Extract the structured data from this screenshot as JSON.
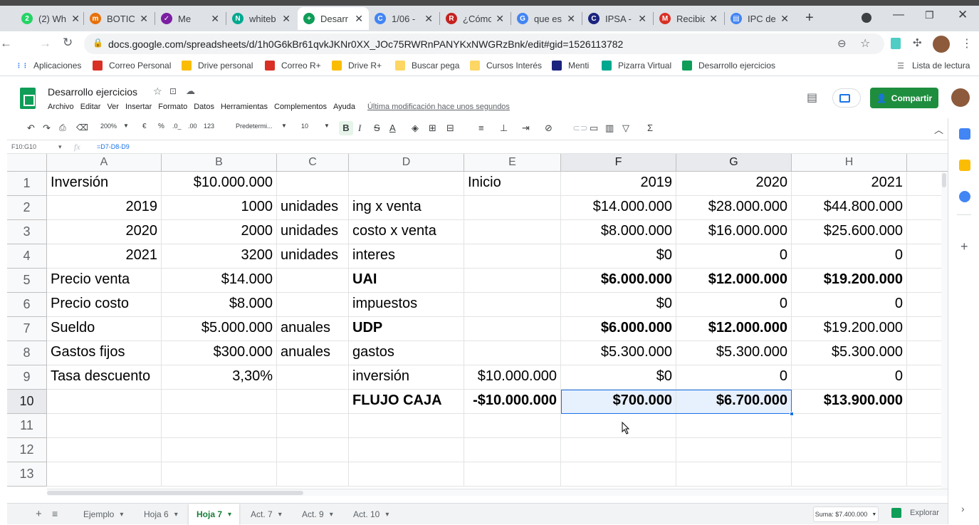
{
  "browser": {
    "tabs": [
      {
        "title": "(2) Wh",
        "icon_color": "#25d366",
        "icon_text": "2"
      },
      {
        "title": "BOTIC",
        "icon_color": "#e8710a",
        "icon_text": "m"
      },
      {
        "title": "Me",
        "icon_color": "#7b1fa2",
        "icon_text": "✓"
      },
      {
        "title": "whiteb",
        "icon_color": "#00a88f",
        "icon_text": "N"
      },
      {
        "title": "Desarr",
        "icon_color": "#0f9d58",
        "icon_text": "+"
      },
      {
        "title": "1/06 -",
        "icon_color": "#4285f4",
        "icon_text": "C"
      },
      {
        "title": "¿Cómo",
        "icon_color": "#c5221f",
        "icon_text": "R"
      },
      {
        "title": "que es",
        "icon_color": "#4285f4",
        "icon_text": "G"
      },
      {
        "title": "IPSA -",
        "icon_color": "#1a237e",
        "icon_text": "C"
      },
      {
        "title": "Recibid",
        "icon_color": "#d93025",
        "icon_text": "M"
      },
      {
        "title": "IPC de",
        "icon_color": "#4285f4",
        "icon_text": "▤"
      }
    ],
    "new_tab_symbol": "+",
    "url": "docs.google.com/spreadsheets/d/1h0G6kBr61qvkJKNr0XX_JOc75RWRnPANYKxNWGRzBnk/edit#gid=1526113782",
    "bookmarks": [
      {
        "label": "Aplicaciones",
        "icon": "apps-icon",
        "color": "#4285f4"
      },
      {
        "label": "Correo Personal",
        "icon": "gmail-icon",
        "color": "#d93025"
      },
      {
        "label": "Drive personal",
        "icon": "drive-icon",
        "color": "#fbbc04"
      },
      {
        "label": "Correo R+",
        "icon": "gmail-icon",
        "color": "#d93025"
      },
      {
        "label": "Drive R+",
        "icon": "drive-icon",
        "color": "#fbbc04"
      },
      {
        "label": "Buscar pega",
        "icon": "folder-icon",
        "color": "#fdd663"
      },
      {
        "label": "Cursos Interés",
        "icon": "folder-icon",
        "color": "#fdd663"
      },
      {
        "label": "Menti",
        "icon": "menti-icon",
        "color": "#1a237e"
      },
      {
        "label": "Pizarra Virtual",
        "icon": "whiteboard-icon",
        "color": "#00a88f"
      },
      {
        "label": "Desarrollo ejercicios",
        "icon": "sheets-icon",
        "color": "#0f9d58"
      }
    ],
    "reading_list": "Lista de lectura"
  },
  "sheets": {
    "title": "Desarrollo ejercicios",
    "menus": [
      "Archivo",
      "Editar",
      "Ver",
      "Insertar",
      "Formato",
      "Datos",
      "Herramientas",
      "Complementos",
      "Ayuda"
    ],
    "last_edit": "Última modificación hace unos segundos",
    "share_label": "Compartir",
    "toolbar": {
      "zoom": "200%",
      "currency": "€",
      "percent": "%",
      "dec_less": ".0_",
      "dec_more": ".00",
      "format_123": "123",
      "font": "Predetermi...",
      "font_size": "10",
      "bold": "B",
      "italic": "I",
      "strike": "S",
      "text_color": "A",
      "sigma": "Σ"
    },
    "name_box": "F10:G10",
    "formula": "=D7-D8-D9",
    "fx": "fx"
  },
  "grid": {
    "columns": [
      "A",
      "B",
      "C",
      "D",
      "E",
      "F",
      "G",
      "H"
    ],
    "rows": [
      [
        "Inversión",
        "$10.000.000",
        "",
        "",
        "Inicio",
        "2019",
        "2020",
        "2021"
      ],
      [
        "2019",
        "1000",
        "unidades",
        "ing x venta",
        "",
        "$14.000.000",
        "$28.000.000",
        "$44.800.000"
      ],
      [
        "2020",
        "2000",
        "unidades",
        "costo x venta",
        "",
        "$8.000.000",
        "$16.000.000",
        "$25.600.000"
      ],
      [
        "2021",
        "3200",
        "unidades",
        "interes",
        "",
        "$0",
        "0",
        "0"
      ],
      [
        "Precio venta",
        "$14.000",
        "",
        "UAI",
        "",
        "$6.000.000",
        "$12.000.000",
        "$19.200.000"
      ],
      [
        "Precio costo",
        "$8.000",
        "",
        "impuestos",
        "",
        "$0",
        "0",
        "0"
      ],
      [
        "Sueldo",
        "$5.000.000",
        "anuales",
        "UDP",
        "",
        "$6.000.000",
        "$12.000.000",
        "$19.200.000"
      ],
      [
        "Gastos fijos",
        "$300.000",
        "anuales",
        "gastos",
        "",
        "$5.300.000",
        "$5.300.000",
        "$5.300.000"
      ],
      [
        "Tasa descuento",
        "3,30%",
        "",
        "inversión",
        "$10.000.000",
        "$0",
        "0",
        "0"
      ],
      [
        "",
        "",
        "",
        "FLUJO CAJA",
        "-$10.000.000",
        "$700.000",
        "$6.700.000",
        "$13.900.000"
      ],
      [
        "",
        "",
        "",
        "",
        "",
        "",
        "",
        ""
      ],
      [
        "",
        "",
        "",
        "",
        "",
        "",
        "",
        ""
      ],
      [
        "",
        "",
        "",
        "",
        "",
        "",
        "",
        ""
      ]
    ],
    "row_numbers": [
      "1",
      "2",
      "3",
      "4",
      "5",
      "6",
      "7",
      "8",
      "9",
      "10",
      "11",
      "12",
      "13"
    ]
  },
  "sheet_tabs": [
    "Ejemplo",
    "Hoja 6",
    "Hoja 7",
    "Act. 7",
    "Act. 9",
    "Act. 10"
  ],
  "active_sheet": "Hoja 7",
  "sum_label": "Suma: $7.400.000",
  "explore_label": "Explorar",
  "colors": {
    "accent": "#1a73e8",
    "sheets_green": "#0f9d58",
    "share_green": "#1e8e3e"
  }
}
